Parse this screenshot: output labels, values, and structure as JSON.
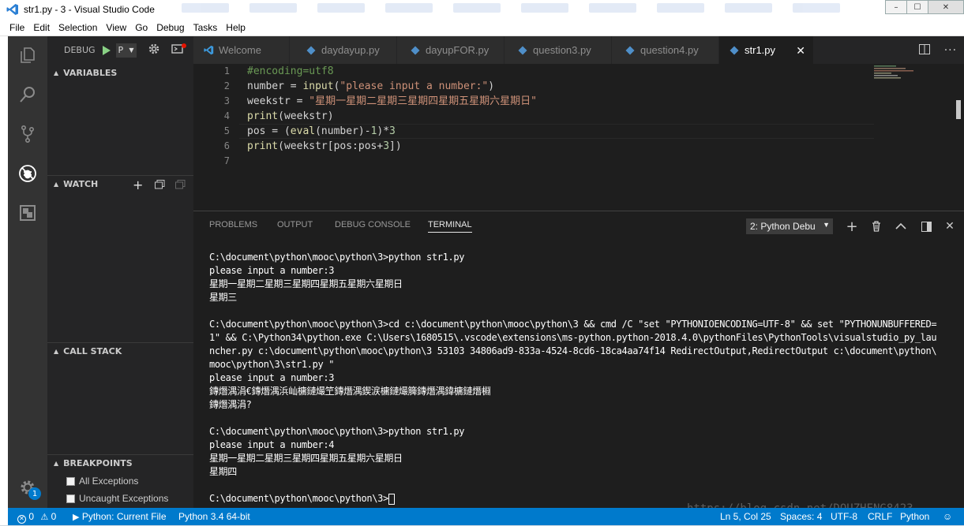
{
  "window": {
    "title": "str1.py - 3 - Visual Studio Code",
    "controls": [
      "–",
      "☐",
      "✕"
    ]
  },
  "menu": [
    "File",
    "Edit",
    "Selection",
    "View",
    "Go",
    "Debug",
    "Tasks",
    "Help"
  ],
  "activitybar": {
    "icons": [
      "explorer-icon",
      "search-icon",
      "source-control-icon",
      "debug-icon",
      "extensions-icon",
      "settings-gear-icon"
    ],
    "settings_badge": "1"
  },
  "sidebar": {
    "debug_label": "DEBUG",
    "config_value": "P",
    "sections": {
      "variables": "VARIABLES",
      "watch": "WATCH",
      "call_stack": "CALL STACK",
      "breakpoints": "BREAKPOINTS"
    },
    "breakpoints": [
      "All Exceptions",
      "Uncaught Exceptions"
    ]
  },
  "tabs": [
    {
      "label": "Welcome",
      "icon": "vscode-icon"
    },
    {
      "label": "daydayup.py",
      "icon": "python-icon"
    },
    {
      "label": "dayupFOR.py",
      "icon": "python-icon"
    },
    {
      "label": "question3.py",
      "icon": "python-icon"
    },
    {
      "label": "question4.py",
      "icon": "python-icon"
    },
    {
      "label": "str1.py",
      "icon": "python-icon",
      "active": true
    }
  ],
  "editor": {
    "line_numbers": [
      "1",
      "2",
      "3",
      "4",
      "5",
      "6",
      "7"
    ],
    "lines": [
      [
        {
          "t": "#encoding=utf8",
          "c": "#6a9955"
        }
      ],
      [
        {
          "t": "number = ",
          "c": "#d4d4d4"
        },
        {
          "t": "input",
          "c": "#dcdcaa"
        },
        {
          "t": "(",
          "c": "#d4d4d4"
        },
        {
          "t": "\"please input a number:\"",
          "c": "#ce9178"
        },
        {
          "t": ")",
          "c": "#d4d4d4"
        }
      ],
      [
        {
          "t": "weekstr = ",
          "c": "#d4d4d4"
        },
        {
          "t": "\"星期一星期二星期三星期四星期五星期六星期日\"",
          "c": "#ce9178"
        }
      ],
      [
        {
          "t": "print",
          "c": "#dcdcaa"
        },
        {
          "t": "(weekstr)",
          "c": "#d4d4d4"
        }
      ],
      [
        {
          "t": "pos = (",
          "c": "#d4d4d4"
        },
        {
          "t": "eval",
          "c": "#dcdcaa"
        },
        {
          "t": "(number)-",
          "c": "#d4d4d4"
        },
        {
          "t": "1",
          "c": "#b5cea8"
        },
        {
          "t": ")*",
          "c": "#d4d4d4"
        },
        {
          "t": "3",
          "c": "#b5cea8"
        }
      ],
      [
        {
          "t": "print",
          "c": "#dcdcaa"
        },
        {
          "t": "(weekstr[pos:pos+",
          "c": "#d4d4d4"
        },
        {
          "t": "3",
          "c": "#b5cea8"
        },
        {
          "t": "])",
          "c": "#d4d4d4"
        }
      ],
      []
    ]
  },
  "panel": {
    "tabs": [
      "PROBLEMS",
      "OUTPUT",
      "DEBUG CONSOLE",
      "TERMINAL"
    ],
    "active_tab": "TERMINAL",
    "terminal_select": "2: Python Debu",
    "terminal_lines": [
      "C:\\document\\python\\mooc\\python\\3>python str1.py",
      "please input a number:3",
      "星期一星期二星期三星期四星期五星期六星期日",
      "星期三",
      "",
      "C:\\document\\python\\mooc\\python\\3>cd c:\\document\\python\\mooc\\python\\3 && cmd /C \"set \"PYTHONIOENCODING=UTF-8\" && set \"PYTHONUNBUFFERED=",
      "1\" && C:\\Python34\\python.exe C:\\Users\\1680515\\.vscode\\extensions\\ms-python.python-2018.4.0\\pythonFiles\\PythonTools\\visualstudio_py_lau",
      "ncher.py c:\\document\\python\\mooc\\python\\3 53103 34806ad9-833a-4524-8cd6-18ca4aa74f14 RedirectOutput,RedirectOutput c:\\document\\python\\",
      "mooc\\python\\3\\str1.py \"",
      "please input a number:3",
      "鏄熸湡涓€鏄熸湡浜屾槦鏈熶笁鏄熸湡鍥涙槦鏈熶簲鏄熸湡鍏槦鏈熸棩",
      "鏄熸湡涓?",
      "",
      "C:\\document\\python\\mooc\\python\\3>python str1.py",
      "please input a number:4",
      "星期一星期二星期三星期四星期五星期六星期日",
      "星期四",
      "",
      "C:\\document\\python\\mooc\\python\\3>"
    ],
    "watermark": "https://blog.csdn.net/DOUZHENG8423"
  },
  "statusbar": {
    "errors": "0",
    "warnings": "0",
    "python_config": "Python: Current File",
    "interpreter": "Python 3.4 64-bit",
    "cursor_pos": "Ln 5, Col 25",
    "spaces": "Spaces: 4",
    "encoding": "UTF-8",
    "eol": "CRLF",
    "language": "Python"
  },
  "colors": {
    "accent": "#007acc",
    "editor_bg": "#1e1e1e",
    "sidebar_bg": "#252526",
    "activity_bg": "#333333",
    "play_green": "#89d185"
  }
}
